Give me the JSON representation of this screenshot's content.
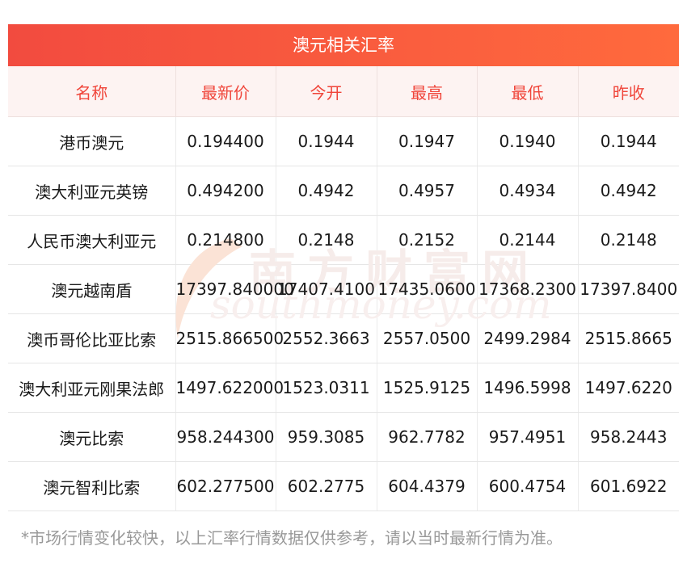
{
  "title": "澳元相关汇率",
  "headers": [
    "名称",
    "最新价",
    "今开",
    "最高",
    "最低",
    "昨收"
  ],
  "rows": [
    [
      "港币澳元",
      "0.194400",
      "0.1944",
      "0.1947",
      "0.1940",
      "0.1944"
    ],
    [
      "澳大利亚元英镑",
      "0.494200",
      "0.4942",
      "0.4957",
      "0.4934",
      "0.4942"
    ],
    [
      "人民币澳大利亚元",
      "0.214800",
      "0.2148",
      "0.2152",
      "0.2144",
      "0.2148"
    ],
    [
      "澳元越南盾",
      "17397.840000",
      "17407.4100",
      "17435.0600",
      "17368.2300",
      "17397.8400"
    ],
    [
      "澳币哥伦比亚比索",
      "2515.866500",
      "2552.3663",
      "2557.0500",
      "2499.2984",
      "2515.8665"
    ],
    [
      "澳大利亚元刚果法郎",
      "1497.622000",
      "1523.0311",
      "1525.9125",
      "1496.5998",
      "1497.6220"
    ],
    [
      "澳元比索",
      "958.244300",
      "959.3085",
      "962.7782",
      "957.4951",
      "958.2443"
    ],
    [
      "澳元智利比索",
      "602.277500",
      "602.2775",
      "604.4379",
      "600.4754",
      "601.6922"
    ]
  ],
  "watermark": {
    "cn": "南方财富网",
    "en": "southmoney.com"
  },
  "note": "*市场行情变化较快，以上汇率行情数据仅供参考，请以当时最新行情为准。",
  "colors": {
    "banner_start": "#f24b3f",
    "banner_end": "#ff6a3d",
    "header_text": "#f0453a",
    "header_bg": "#fdf3f2",
    "note_text": "#999999"
  }
}
